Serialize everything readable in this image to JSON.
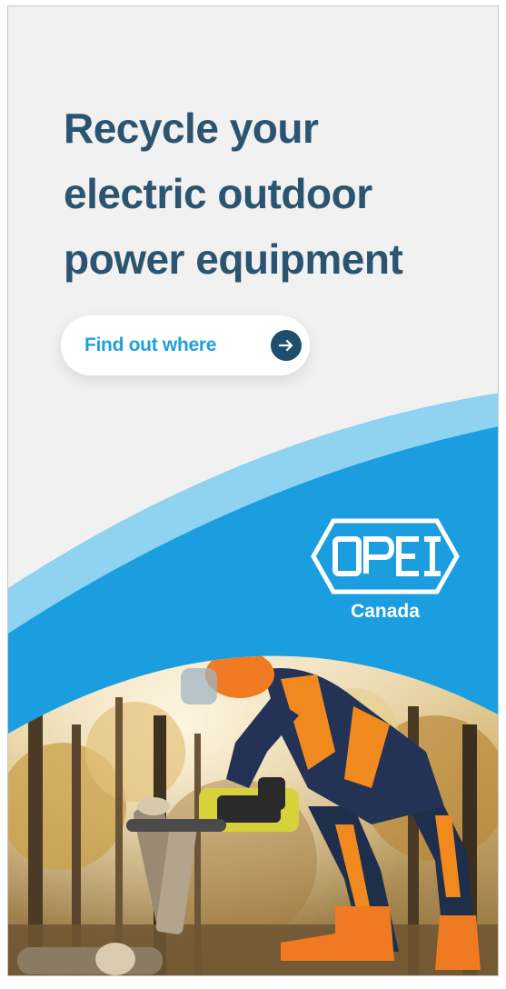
{
  "banner": {
    "headline": "Recycle your\nelectric outdoor\npower equipment",
    "cta": {
      "label": "Find out where",
      "icon": "arrow-right-icon"
    },
    "logo": {
      "mark_text": "OPEI",
      "subtitle": "Canada"
    },
    "photo": {
      "subject": "worker cutting logs with cordless chainsaw in autumn forest"
    }
  },
  "colors": {
    "background": "#f1f1f1",
    "headline": "#2a5470",
    "cta_text": "#20a0d8",
    "cta_arrow_bg": "#1f4f6e",
    "wave_light": "#8fd3f0",
    "wave_main": "#1a9ee0"
  }
}
